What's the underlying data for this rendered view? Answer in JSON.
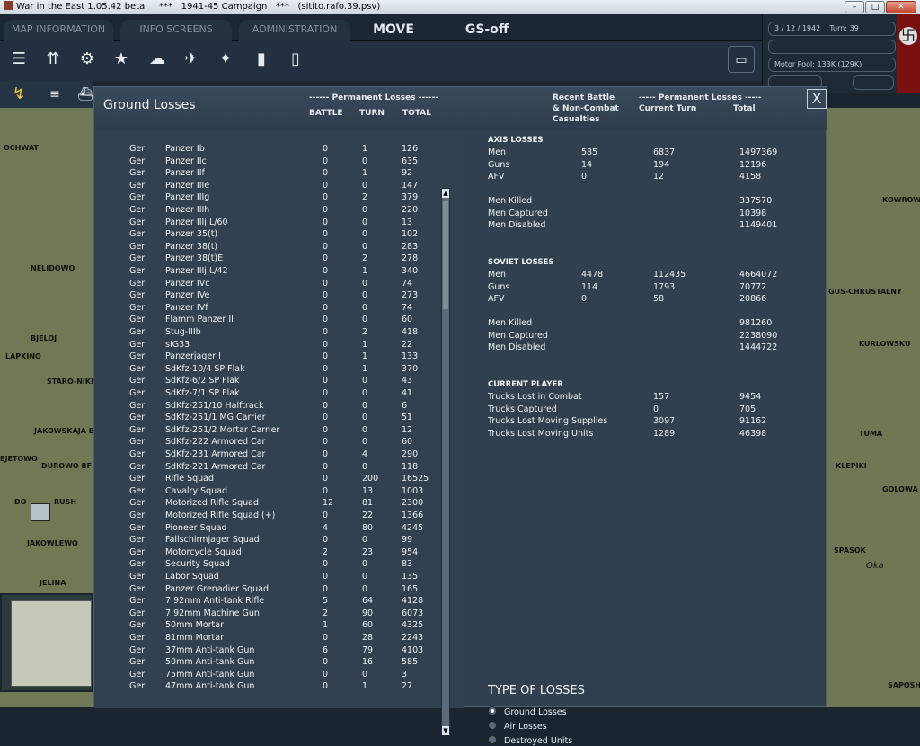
{
  "window": {
    "title": "War in the East 1.05.42 beta     ***   1941-45 Campaign   ***   (sitito.rafo.39.psv)"
  },
  "topbar": {
    "tabs": [
      "MAP INFORMATION",
      "INFO SCREENS",
      "ADMINISTRATION"
    ],
    "mode": "MOVE",
    "gs": "GS-off"
  },
  "status": {
    "date": "3 / 12 / 1942",
    "turn": "Turn: 39",
    "motor_pool": "Motor Pool: 133K (129K)"
  },
  "map_labels": {
    "left": [
      "OCHWAT",
      "NELIDOWO",
      "BJELOJ",
      "LAPKINO",
      "STARO-NIKE",
      "JAKOWSKAJA B",
      "EJETOWO",
      "DUROWO BF",
      "DO",
      "RUSH",
      "JAKOWLEWO",
      "JELINA"
    ],
    "right": [
      "KOWROW",
      "GUS-CHRUSTALNY",
      "KURLOWSKU",
      "TUMA",
      "KLEPIKI",
      "GOLOWA",
      "SPASOK",
      "Oka",
      "SAPOSH"
    ]
  },
  "panel": {
    "title": "Ground Losses",
    "left_header_group": "------ Permanent Losses ------",
    "left_cols": [
      "BATTLE",
      "TURN",
      "TOTAL"
    ],
    "right_header_recent": [
      "Recent Battle",
      "& Non-Combat",
      "Casualties"
    ],
    "right_header_group": "----- Permanent Losses -----",
    "right_cols": [
      "Current Turn",
      "Total"
    ],
    "close": "X",
    "units": [
      [
        "Ger",
        "Panzer Ib",
        "0",
        "1",
        "126"
      ],
      [
        "Ger",
        "Panzer IIc",
        "0",
        "0",
        "635"
      ],
      [
        "Ger",
        "Panzer IIf",
        "0",
        "1",
        "92"
      ],
      [
        "Ger",
        "Panzer IIIe",
        "0",
        "0",
        "147"
      ],
      [
        "Ger",
        "Panzer IIIg",
        "0",
        "2",
        "379"
      ],
      [
        "Ger",
        "Panzer IIIh",
        "0",
        "0",
        "220"
      ],
      [
        "Ger",
        "Panzer IIIj L/60",
        "0",
        "0",
        "13"
      ],
      [
        "Ger",
        "Panzer 35(t)",
        "0",
        "0",
        "102"
      ],
      [
        "Ger",
        "Panzer 38(t)",
        "0",
        "0",
        "283"
      ],
      [
        "Ger",
        "Panzer 38(t)E",
        "0",
        "2",
        "278"
      ],
      [
        "Ger",
        "Panzer IIIj L/42",
        "0",
        "1",
        "340"
      ],
      [
        "Ger",
        "Panzer IVc",
        "0",
        "0",
        "74"
      ],
      [
        "Ger",
        "Panzer IVe",
        "0",
        "0",
        "273"
      ],
      [
        "Ger",
        "Panzer IVf",
        "0",
        "0",
        "74"
      ],
      [
        "Ger",
        "Flamm Panzer II",
        "0",
        "0",
        "60"
      ],
      [
        "Ger",
        "Stug-IIIb",
        "0",
        "2",
        "418"
      ],
      [
        "Ger",
        "sIG33",
        "0",
        "1",
        "22"
      ],
      [
        "Ger",
        "Panzerjager I",
        "0",
        "1",
        "133"
      ],
      [
        "Ger",
        "SdKfz-10/4 SP Flak",
        "0",
        "1",
        "370"
      ],
      [
        "Ger",
        "SdKfz-6/2 SP Flak",
        "0",
        "0",
        "43"
      ],
      [
        "Ger",
        "SdKfz-7/1 SP Flak",
        "0",
        "0",
        "41"
      ],
      [
        "Ger",
        "SdKfz-251/10 Halftrack",
        "0",
        "0",
        "6"
      ],
      [
        "Ger",
        "SdKfz-251/1 MG Carrier",
        "0",
        "0",
        "51"
      ],
      [
        "Ger",
        "SdKfz-251/2 Mortar Carrier",
        "0",
        "0",
        "12"
      ],
      [
        "Ger",
        "SdKfz-222 Armored Car",
        "0",
        "0",
        "60"
      ],
      [
        "Ger",
        "SdKfz-231 Armored Car",
        "0",
        "4",
        "290"
      ],
      [
        "Ger",
        "SdKfz-221 Armored Car",
        "0",
        "0",
        "118"
      ],
      [
        "Ger",
        "Rifle Squad",
        "0",
        "200",
        "16525"
      ],
      [
        "Ger",
        "Cavalry Squad",
        "0",
        "13",
        "1003"
      ],
      [
        "Ger",
        "Motorized Rifle Squad",
        "12",
        "81",
        "2300"
      ],
      [
        "Ger",
        "Motorized Rifle Squad (+)",
        "0",
        "22",
        "1366"
      ],
      [
        "Ger",
        "Pioneer Squad",
        "4",
        "80",
        "4245"
      ],
      [
        "Ger",
        "Fallschirmjager Squad",
        "0",
        "0",
        "99"
      ],
      [
        "Ger",
        "Motorcycle Squad",
        "2",
        "23",
        "954"
      ],
      [
        "Ger",
        "Security Squad",
        "0",
        "0",
        "83"
      ],
      [
        "Ger",
        "Labor Squad",
        "0",
        "0",
        "135"
      ],
      [
        "Ger",
        "Panzer Grenadier Squad",
        "0",
        "0",
        "165"
      ],
      [
        "Ger",
        "7.92mm Anti-tank Rifle",
        "5",
        "64",
        "4128"
      ],
      [
        "Ger",
        "7.92mm Machine Gun",
        "2",
        "90",
        "6073"
      ],
      [
        "Ger",
        "50mm Mortar",
        "1",
        "60",
        "4325"
      ],
      [
        "Ger",
        "81mm Mortar",
        "0",
        "28",
        "2243"
      ],
      [
        "Ger",
        "37mm Anti-tank Gun",
        "6",
        "79",
        "4103"
      ],
      [
        "Ger",
        "50mm Anti-tank Gun",
        "0",
        "16",
        "585"
      ],
      [
        "Ger",
        "75mm Anti-tank Gun",
        "0",
        "0",
        "3"
      ],
      [
        "Ger",
        "47mm Anti-tank Gun",
        "0",
        "1",
        "27"
      ]
    ],
    "axis": {
      "title": "AXIS LOSSES",
      "rows": [
        [
          "Men",
          "585",
          "6837",
          "1497369"
        ],
        [
          "Guns",
          "14",
          "194",
          "12196"
        ],
        [
          "AFV",
          "0",
          "12",
          "4158"
        ]
      ],
      "summary": [
        [
          "Men Killed",
          "337570"
        ],
        [
          "Men Captured",
          "10398"
        ],
        [
          "Men Disabled",
          "1149401"
        ]
      ]
    },
    "soviet": {
      "title": "SOVIET LOSSES",
      "rows": [
        [
          "Men",
          "4478",
          "112435",
          "4664072"
        ],
        [
          "Guns",
          "114",
          "1793",
          "70772"
        ],
        [
          "AFV",
          "0",
          "58",
          "20866"
        ]
      ],
      "summary": [
        [
          "Men Killed",
          "981260"
        ],
        [
          "Men Captured",
          "2238090"
        ],
        [
          "Men Disabled",
          "1444722"
        ]
      ]
    },
    "player": {
      "title": "CURRENT PLAYER",
      "rows": [
        [
          "Trucks Lost in Combat",
          "157",
          "9454"
        ],
        [
          "Trucks Captured",
          "0",
          "705"
        ],
        [
          "Trucks Lost Moving Supplies",
          "3097",
          "91162"
        ],
        [
          "Trucks Lost Moving Units",
          "1289",
          "46398"
        ]
      ]
    },
    "type_title": "TYPE OF LOSSES",
    "type_options": [
      "Ground Losses",
      "Air Losses",
      "Destroyed Units"
    ],
    "type_selected": 0
  }
}
